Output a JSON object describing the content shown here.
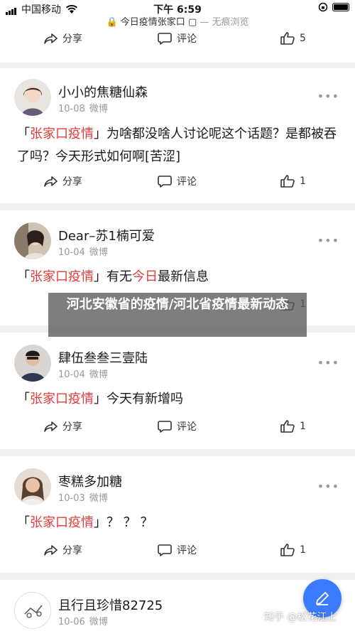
{
  "status_bar": {
    "carrier": "中国移动",
    "time": "下午 6:59"
  },
  "url_bar": {
    "title": "今日疫情张家口",
    "mode": "— 无痕浏览"
  },
  "actions": {
    "share_label": "分享",
    "comment_label": "评论"
  },
  "more_label": "•••",
  "top_card": {
    "likes": "5"
  },
  "posts": [
    {
      "user": "小小的焦糖仙森",
      "date": "10-08",
      "source": "微博",
      "text_red": "张家口疫情",
      "text_rest": "为啥都没啥人讨论呢这个话题？是都被吞了吗？今天形式如何啊[苦涩]",
      "likes": "1"
    },
    {
      "user": "Dear–苏1楠可爱",
      "date": "10-04",
      "source": "微博",
      "text_red": "张家口疫情",
      "text_mid": "有无",
      "text_red2": "今日",
      "text_rest": "最新信息",
      "likes": "1"
    },
    {
      "user": "肆伍叁叁三壹陆",
      "date": "10-04",
      "source": "微博",
      "text_red": "张家口疫情",
      "text_rest": "今天有新增吗",
      "likes": "1"
    },
    {
      "user": "枣糕多加糖",
      "date": "10-03",
      "source": "微博",
      "text_red": "张家口疫情",
      "text_rest": "？ ？ ？",
      "likes": "1"
    },
    {
      "user": "且行且珍惜82725",
      "date": "10-06",
      "source": "微博"
    }
  ],
  "overlay": {
    "title": "河北安徽省的疫情/河北省疫情最新动态"
  },
  "watermark": "知乎 @松花江上",
  "colors": {
    "highlight": "#e23b3b",
    "fab": "#3b7bff"
  },
  "icons": [
    "share-icon",
    "comment-icon",
    "like-icon",
    "edit-icon",
    "lock-icon",
    "tab-icon",
    "wifi-icon",
    "signal-icon",
    "battery-icon"
  ]
}
